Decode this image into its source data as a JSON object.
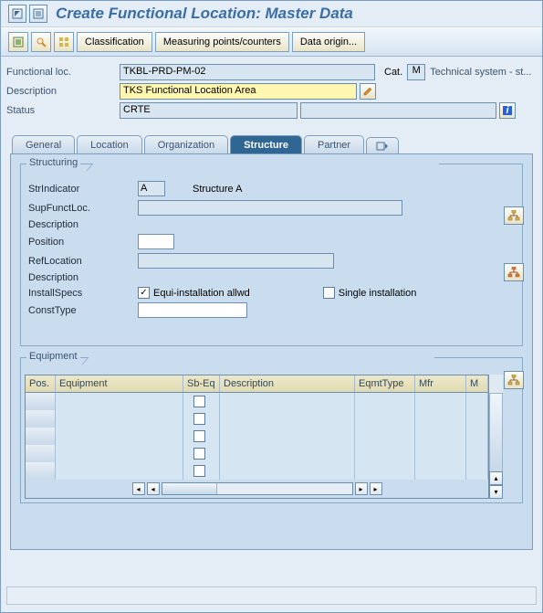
{
  "title": "Create Functional Location: Master Data",
  "toolbar": {
    "classification": "Classification",
    "measuring": "Measuring points/counters",
    "data_origin": "Data origin..."
  },
  "header": {
    "functional_loc_label": "Functional loc.",
    "functional_loc_value": "TKBL-PRD-PM-02",
    "cat_label": "Cat.",
    "cat_value": "M",
    "cat_text": "Technical system - st...",
    "description_label": "Description",
    "description_value": "TKS Functional Location Area",
    "status_label": "Status",
    "status_value": "CRTE"
  },
  "tabs": {
    "general": "General",
    "location": "Location",
    "organization": "Organization",
    "structure": "Structure",
    "partner": "Partner"
  },
  "structuring": {
    "group_title": "Structuring",
    "strindicator_label": "StrIndicator",
    "strindicator_value": "A",
    "strindicator_text": "Structure A",
    "supfunctloc_label": "SupFunctLoc.",
    "supfunctloc_value": "",
    "description_label": "Description",
    "position_label": "Position",
    "position_value": "",
    "reflocation_label": "RefLocation",
    "reflocation_value": "",
    "description2_label": "Description",
    "installspecs_label": "InstallSpecs",
    "equi_installation_label": "Equi-installation allwd",
    "equi_installation_checked": true,
    "single_installation_label": "Single installation",
    "single_installation_checked": false,
    "consttype_label": "ConstType",
    "consttype_value": ""
  },
  "equipment": {
    "group_title": "Equipment",
    "columns": {
      "pos": "Pos.",
      "equipment": "Equipment",
      "sb_eq": "Sb-Eq",
      "description": "Description",
      "eqmttype": "EqmtType",
      "mfr": "Mfr",
      "m": "M"
    }
  }
}
